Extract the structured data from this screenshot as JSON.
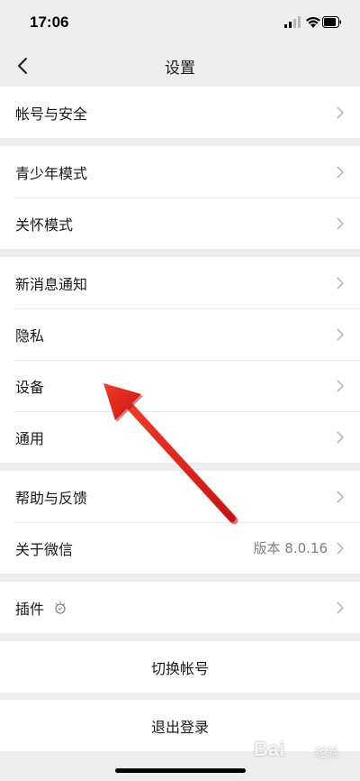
{
  "status_bar": {
    "time": "17:06",
    "icons": [
      "signal-icon",
      "wifi-icon",
      "battery-icon"
    ]
  },
  "nav": {
    "back_icon": "chevron-left-icon",
    "title": "设置"
  },
  "groups": {
    "g1": {
      "items": [
        {
          "label": "帐号与安全"
        }
      ]
    },
    "g2": {
      "items": [
        {
          "label": "青少年模式"
        },
        {
          "label": "关怀模式"
        }
      ]
    },
    "g3": {
      "items": [
        {
          "label": "新消息通知"
        },
        {
          "label": "隐私"
        },
        {
          "label": "设备"
        },
        {
          "label": "通用"
        }
      ]
    },
    "g4": {
      "items": [
        {
          "label": "帮助与反馈"
        },
        {
          "label": "关于微信",
          "value": "版本 8.0.16"
        }
      ]
    },
    "g5": {
      "items": [
        {
          "label": "插件",
          "icon": "plugin-icon"
        }
      ]
    }
  },
  "actions": {
    "switch_account": "切换帐号",
    "logout": "退出登录"
  },
  "watermark": {
    "text": "Bai",
    "sub": "经验"
  },
  "colors": {
    "background": "#ededed",
    "card": "#ffffff",
    "text": "#191919",
    "secondary_text": "#7f7f7f",
    "chevron": "#b2b2b2",
    "annotation_arrow": "#e02020"
  }
}
